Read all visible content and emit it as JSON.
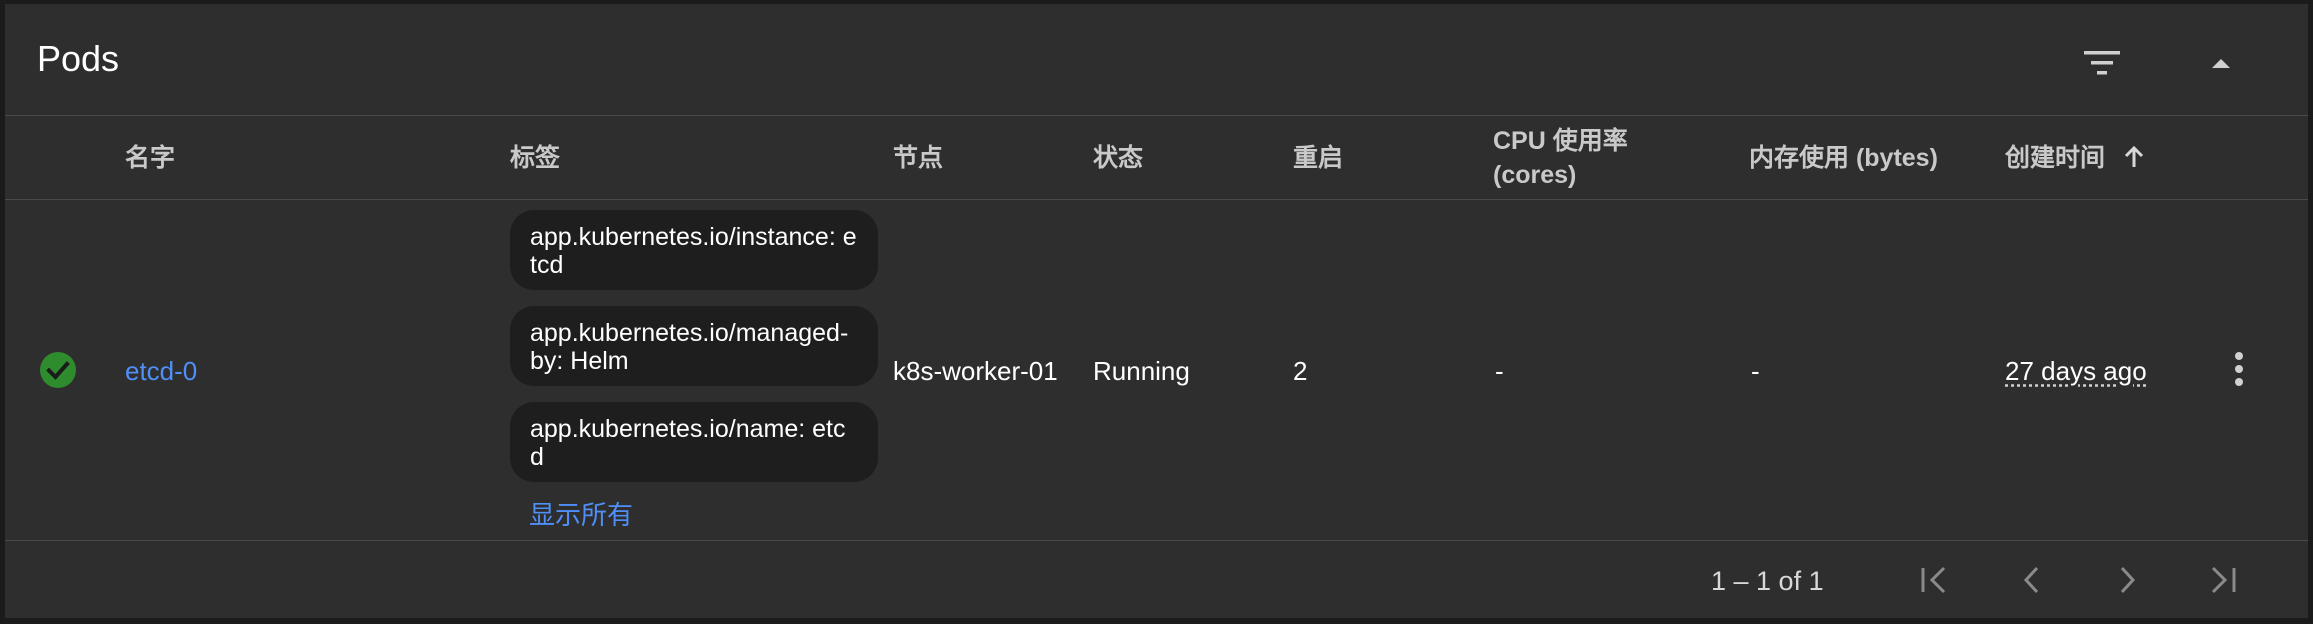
{
  "card": {
    "title": "Pods"
  },
  "columns": {
    "name": "名字",
    "labels": "标签",
    "node": "节点",
    "status": "状态",
    "restarts": "重启",
    "cpu": "CPU 使用率 (cores)",
    "memory": "内存使用 (bytes)",
    "created": "创建时间"
  },
  "rows": [
    {
      "status_icon": "check-circle-icon",
      "status_color": "#2e8b2e",
      "name": "etcd-0",
      "labels": [
        "app.kubernetes.io/instance: etcd",
        "app.kubernetes.io/managed-by: Helm",
        "app.kubernetes.io/name: etcd"
      ],
      "show_all": "显示所有",
      "node": "k8s-worker-01",
      "status": "Running",
      "restarts": "2",
      "cpu": "-",
      "memory": "-",
      "created": "27 days ago"
    }
  ],
  "paginator": {
    "range_label": "1 – 1 of 1"
  },
  "colors": {
    "background": "#2e2e2e",
    "link": "#4f8ff7",
    "divider": "#4a4a4a",
    "chip": "#1e1e1e"
  }
}
